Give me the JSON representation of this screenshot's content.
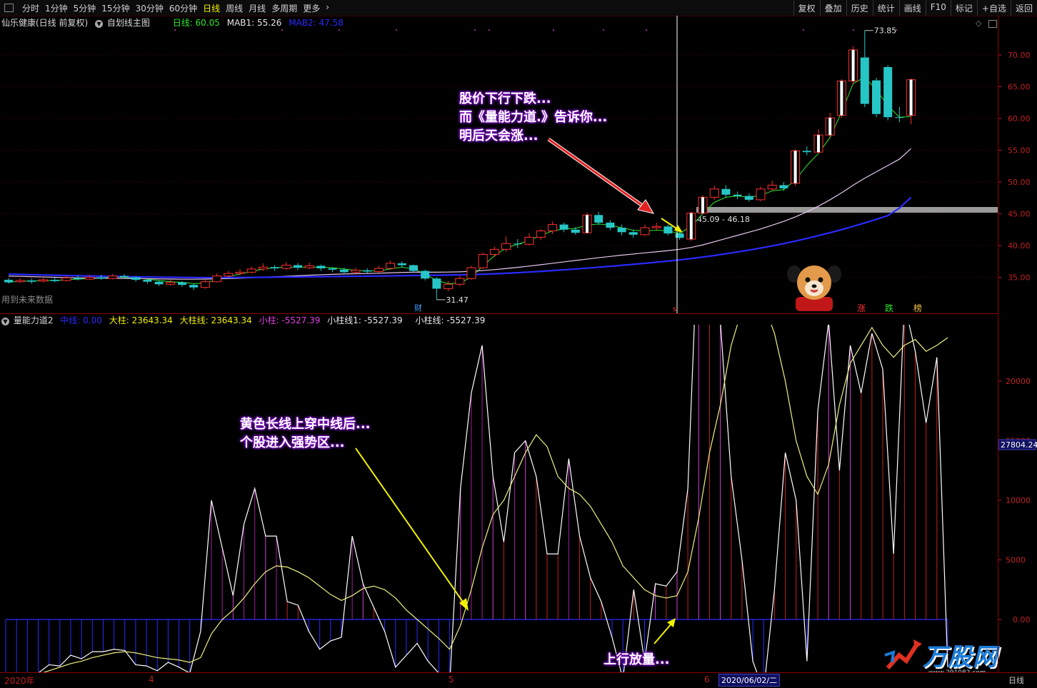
{
  "toolbar": {
    "periods": [
      "分时",
      "1分钟",
      "5分钟",
      "15分钟",
      "30分钟",
      "60分钟",
      "日线",
      "周线",
      "月线",
      "多周期",
      "更多"
    ],
    "active_period": "日线",
    "right_buttons": [
      "复权",
      "叠加",
      "历史",
      "统计",
      "画线",
      "F10",
      "标记",
      "+自选",
      "返回"
    ]
  },
  "main_info": {
    "stock": "仙乐健康(日线 前复权)",
    "chart_mode": "自划线主图",
    "day_label": "日线: 60.05",
    "mab1": "MAB1: 55.26",
    "mab2": "MAB2: 47.58",
    "colors": {
      "day": "#2ee62e",
      "mab1": "#ffffff",
      "mab2": "#2a2aff"
    }
  },
  "indicator_info": {
    "name": "量能力道2",
    "zhongxian": "中线: 0.00",
    "dazhu": "大柱: 23643.34",
    "dazhuxian": "大柱线: 23643.34",
    "xiaozhu": "小柱: -5527.39",
    "xiaozhuxian1": "小柱线1: -5527.39",
    "xiaozhuxian": "小柱线: -5527.39"
  },
  "annotations": {
    "top_callout": [
      "股价下行下跌...",
      "而《量能力道.》告诉你...",
      "明后天会涨..."
    ],
    "mid_callout": [
      "黄色长线上穿中线后...",
      "个股进入强势区..."
    ],
    "bottom_callout": "上行放量...",
    "range_label": "45.09 - 46.18",
    "high_label": "73.85",
    "low_label": "31.47",
    "future_note": "用到未来数据",
    "cai_marker": "财",
    "rank_words": [
      "涨",
      "跌",
      "榜"
    ],
    "current_value": "27804.24",
    "date_marker": "2020/06/02/二",
    "axis_right_label": "日线",
    "watermark": "万股网",
    "watermark_url": "www.291082.com"
  },
  "chart_data": [
    {
      "type": "candlestick",
      "title": "仙乐健康(日线 前复权)",
      "ylim": [
        31,
        75
      ],
      "y_ticks": [
        35.0,
        40.0,
        45.0,
        50.0,
        55.0,
        60.0,
        65.0,
        70.0
      ],
      "x_tick_labels": [
        "2020年",
        "4",
        "5",
        "6"
      ],
      "candles": [
        [
          34.6,
          34.2,
          34.9,
          34.0
        ],
        [
          34.3,
          34.5,
          34.8,
          34.1
        ],
        [
          34.5,
          34.3,
          34.8,
          34.0
        ],
        [
          34.4,
          34.6,
          34.9,
          34.2
        ],
        [
          34.6,
          34.4,
          34.9,
          34.2
        ],
        [
          34.5,
          34.9,
          35.2,
          34.3
        ],
        [
          34.9,
          34.7,
          35.3,
          34.5
        ],
        [
          34.7,
          35.0,
          35.4,
          34.6
        ],
        [
          35.0,
          34.8,
          35.4,
          34.6
        ],
        [
          34.8,
          35.2,
          35.5,
          34.7
        ],
        [
          35.2,
          35.0,
          35.5,
          34.8
        ],
        [
          35.0,
          34.6,
          35.1,
          34.3
        ],
        [
          34.6,
          34.3,
          34.8,
          34.0
        ],
        [
          34.3,
          33.9,
          34.5,
          33.6
        ],
        [
          33.9,
          34.2,
          34.6,
          33.7
        ],
        [
          34.2,
          33.8,
          34.4,
          33.5
        ],
        [
          33.8,
          33.4,
          34.0,
          33.0
        ],
        [
          33.4,
          34.3,
          34.6,
          33.2
        ],
        [
          34.3,
          35.2,
          35.6,
          34.2
        ],
        [
          35.2,
          35.6,
          36.0,
          35.0
        ],
        [
          35.6,
          35.8,
          36.3,
          35.4
        ],
        [
          35.8,
          36.3,
          36.7,
          35.6
        ],
        [
          36.3,
          36.6,
          37.2,
          36.0
        ],
        [
          36.6,
          36.4,
          36.9,
          36.0
        ],
        [
          36.4,
          36.9,
          37.4,
          36.2
        ],
        [
          36.9,
          36.5,
          37.2,
          36.1
        ],
        [
          36.5,
          36.8,
          37.3,
          36.3
        ],
        [
          36.8,
          36.4,
          37.0,
          36.0
        ],
        [
          36.4,
          36.2,
          36.6,
          35.8
        ],
        [
          36.2,
          35.8,
          36.5,
          35.5
        ],
        [
          35.8,
          36.1,
          36.5,
          35.6
        ],
        [
          36.1,
          35.9,
          36.4,
          35.6
        ],
        [
          35.9,
          36.4,
          36.8,
          35.7
        ],
        [
          36.4,
          37.2,
          37.6,
          36.2
        ],
        [
          37.2,
          36.9,
          37.5,
          36.5
        ],
        [
          36.9,
          36.0,
          37.0,
          35.7
        ],
        [
          36.0,
          34.8,
          36.2,
          34.5
        ],
        [
          34.8,
          33.2,
          35.0,
          31.47
        ],
        [
          33.2,
          33.9,
          34.4,
          32.8
        ],
        [
          33.9,
          34.8,
          35.2,
          33.6
        ],
        [
          34.8,
          36.5,
          36.8,
          34.6
        ],
        [
          36.5,
          38.6,
          38.9,
          36.3
        ],
        [
          38.6,
          39.4,
          39.8,
          38.2
        ],
        [
          39.4,
          40.3,
          41.4,
          39.0
        ],
        [
          40.3,
          40.2,
          41.0,
          39.6
        ],
        [
          40.2,
          41.3,
          41.9,
          40.0
        ],
        [
          41.3,
          42.3,
          42.6,
          40.9
        ],
        [
          42.3,
          43.3,
          43.8,
          41.8
        ],
        [
          43.3,
          42.5,
          43.6,
          42.1
        ],
        [
          42.5,
          42.0,
          42.9,
          41.7
        ],
        [
          42.0,
          44.8,
          45.2,
          41.9
        ],
        [
          44.8,
          43.6,
          45.3,
          43.2
        ],
        [
          43.6,
          42.8,
          44.0,
          42.4
        ],
        [
          42.8,
          42.1,
          43.3,
          41.6
        ],
        [
          42.1,
          41.7,
          42.5,
          41.2
        ],
        [
          41.7,
          42.8,
          43.3,
          41.5
        ],
        [
          42.8,
          43.0,
          43.6,
          42.4
        ],
        [
          43.0,
          41.9,
          43.3,
          41.6
        ],
        [
          41.9,
          41.2,
          42.3,
          40.9
        ],
        [
          41.0,
          45.1,
          45.4,
          40.7
        ],
        [
          45.1,
          47.6,
          47.9,
          44.9
        ],
        [
          47.6,
          48.9,
          49.4,
          47.2
        ],
        [
          48.9,
          48.0,
          49.5,
          47.6
        ],
        [
          48.0,
          47.8,
          48.5,
          47.3
        ],
        [
          47.8,
          47.2,
          48.2,
          46.9
        ],
        [
          47.2,
          48.9,
          49.3,
          47.0
        ],
        [
          48.9,
          49.5,
          50.2,
          48.6
        ],
        [
          49.5,
          49.0,
          50.0,
          48.6
        ],
        [
          49.8,
          54.9,
          55.2,
          49.4
        ],
        [
          54.9,
          54.7,
          55.6,
          54.2
        ],
        [
          54.7,
          57.4,
          58.3,
          54.5
        ],
        [
          57.4,
          60.1,
          60.9,
          57.0
        ],
        [
          60.5,
          65.9,
          66.2,
          60.1
        ],
        [
          65.9,
          70.8,
          71.4,
          65.4
        ],
        [
          69.6,
          62.3,
          73.85,
          61.8
        ],
        [
          66.0,
          60.7,
          66.4,
          60.2
        ],
        [
          68.1,
          60.2,
          68.4,
          59.7
        ],
        [
          60.2,
          60.1,
          61.8,
          59.4
        ],
        [
          60.5,
          66.1,
          66.3,
          59.1
        ]
      ],
      "series": [
        {
          "name": "日线",
          "values": [
            34.2,
            34.4,
            34.4,
            34.5,
            34.5,
            34.6,
            34.7,
            34.8,
            34.9,
            35.0,
            35.0,
            34.9,
            34.7,
            34.5,
            34.3,
            34.2,
            34.0,
            34.1,
            34.6,
            35.1,
            35.5,
            35.9,
            36.3,
            36.5,
            36.6,
            36.6,
            36.6,
            36.6,
            36.5,
            36.3,
            36.1,
            36.0,
            36.0,
            36.3,
            36.6,
            36.3,
            35.5,
            34.5,
            34.0,
            34.1,
            35.0,
            36.8,
            38.4,
            39.6,
            40.2,
            40.8,
            41.6,
            42.3,
            42.6,
            42.7,
            43.2,
            43.4,
            43.2,
            42.8,
            42.4,
            42.3,
            42.4,
            42.3,
            41.9,
            43.0,
            45.0,
            46.8,
            47.6,
            47.8,
            47.6,
            47.9,
            48.6,
            48.8,
            50.3,
            52.6,
            54.5,
            57.0,
            61.0,
            65.5,
            66.5,
            64.5,
            62.0,
            60.2,
            60.3
          ]
        },
        {
          "name": "MAB1",
          "values": [
            35.2,
            35.15,
            35.1,
            35.05,
            35.0,
            34.95,
            34.9,
            34.88,
            34.86,
            34.84,
            34.82,
            34.8,
            34.78,
            34.75,
            34.72,
            34.7,
            34.7,
            34.72,
            34.76,
            34.8,
            34.86,
            34.92,
            35.0,
            35.08,
            35.16,
            35.24,
            35.32,
            35.4,
            35.46,
            35.52,
            35.56,
            35.6,
            35.64,
            35.7,
            35.76,
            35.8,
            35.8,
            35.8,
            35.82,
            35.86,
            35.94,
            36.06,
            36.2,
            36.38,
            36.56,
            36.76,
            36.98,
            37.2,
            37.42,
            37.64,
            37.86,
            38.08,
            38.28,
            38.48,
            38.66,
            38.84,
            39.02,
            39.2,
            39.4,
            39.7,
            40.1,
            40.6,
            41.1,
            41.6,
            42.1,
            42.6,
            43.2,
            43.8,
            44.5,
            45.3,
            46.2,
            47.2,
            48.3,
            49.5,
            50.6,
            51.6,
            52.6,
            53.6,
            55.26
          ]
        },
        {
          "name": "MAB2",
          "values": [
            35.5,
            35.45,
            35.4,
            35.36,
            35.32,
            35.28,
            35.24,
            35.2,
            35.17,
            35.14,
            35.11,
            35.08,
            35.05,
            35.02,
            35.0,
            34.98,
            34.96,
            34.95,
            34.95,
            34.96,
            34.97,
            34.98,
            35.0,
            35.02,
            35.04,
            35.06,
            35.08,
            35.1,
            35.12,
            35.14,
            35.16,
            35.18,
            35.2,
            35.22,
            35.25,
            35.28,
            35.3,
            35.32,
            35.35,
            35.38,
            35.42,
            35.48,
            35.55,
            35.63,
            35.72,
            35.82,
            35.93,
            36.05,
            36.17,
            36.3,
            36.44,
            36.58,
            36.73,
            36.88,
            37.04,
            37.2,
            37.37,
            37.55,
            37.74,
            37.95,
            38.18,
            38.43,
            38.7,
            38.98,
            39.28,
            39.6,
            39.94,
            40.3,
            40.7,
            41.12,
            41.56,
            42.02,
            42.5,
            43.02,
            43.56,
            44.12,
            44.7,
            45.9,
            47.58
          ]
        }
      ]
    },
    {
      "type": "bar",
      "title": "量能力道2",
      "ylim": [
        -9000,
        49000
      ],
      "y_ticks": [
        0,
        5000,
        10000,
        15000,
        20000,
        25000,
        30000,
        35000,
        40000,
        45000
      ],
      "series": [
        {
          "name": "大柱",
          "values": [
            -5500,
            -5300,
            -6600,
            -4500,
            -3800,
            -3900,
            -3000,
            -3300,
            -2700,
            -2700,
            -2500,
            -2600,
            -3800,
            -3900,
            -4300,
            -3600,
            -4000,
            -4500,
            -1000,
            10000,
            6000,
            2000,
            8000,
            11000,
            7000,
            7000,
            1500,
            1200,
            -1000,
            -2500,
            -1800,
            -1500,
            7000,
            3000,
            1000,
            -1000,
            -4000,
            -3000,
            -2000,
            -3500,
            -4500,
            -5500,
            11000,
            19000,
            23000,
            12000,
            6500,
            14000,
            15000,
            12000,
            5500,
            5500,
            13500,
            7000,
            3500,
            1500,
            -1500,
            -5000,
            2500,
            -3500,
            3000,
            2800,
            4000,
            11000,
            34000,
            48000,
            25000,
            12000,
            5000,
            -3500,
            -6000,
            2500,
            14000,
            10000,
            -3500,
            17500,
            25000,
            12500,
            23000,
            19000,
            24000,
            21000,
            5500,
            26500,
            22500,
            16500,
            22000,
            -4000
          ]
        },
        {
          "name": "中线",
          "values": [
            -5527.39,
            -5200,
            -5000,
            -4600,
            -4300,
            -4000,
            -3700,
            -3500,
            -3200,
            -3000,
            -2800,
            -2700,
            -2800,
            -3000,
            -3200,
            -3300,
            -3400,
            -3600,
            -3200,
            -1200,
            0,
            800,
            1800,
            3000,
            4000,
            4500,
            4400,
            4000,
            3500,
            2800,
            2100,
            1600,
            2000,
            2600,
            2800,
            2500,
            1800,
            800,
            0,
            -800,
            -1600,
            -2500,
            -500,
            2500,
            6000,
            8800,
            10000,
            12000,
            14000,
            15500,
            14500,
            12000,
            11000,
            10500,
            9500,
            8000,
            6500,
            4500,
            3500,
            2500,
            2000,
            1800,
            2000,
            4000,
            8500,
            14000,
            18000,
            23000,
            26000,
            26500,
            26500,
            24000,
            20000,
            15000,
            12000,
            10500,
            13000,
            18000,
            21500,
            23000,
            24500,
            23000,
            22000,
            23000,
            23500,
            22500,
            23000,
            23643.34
          ]
        }
      ]
    }
  ]
}
